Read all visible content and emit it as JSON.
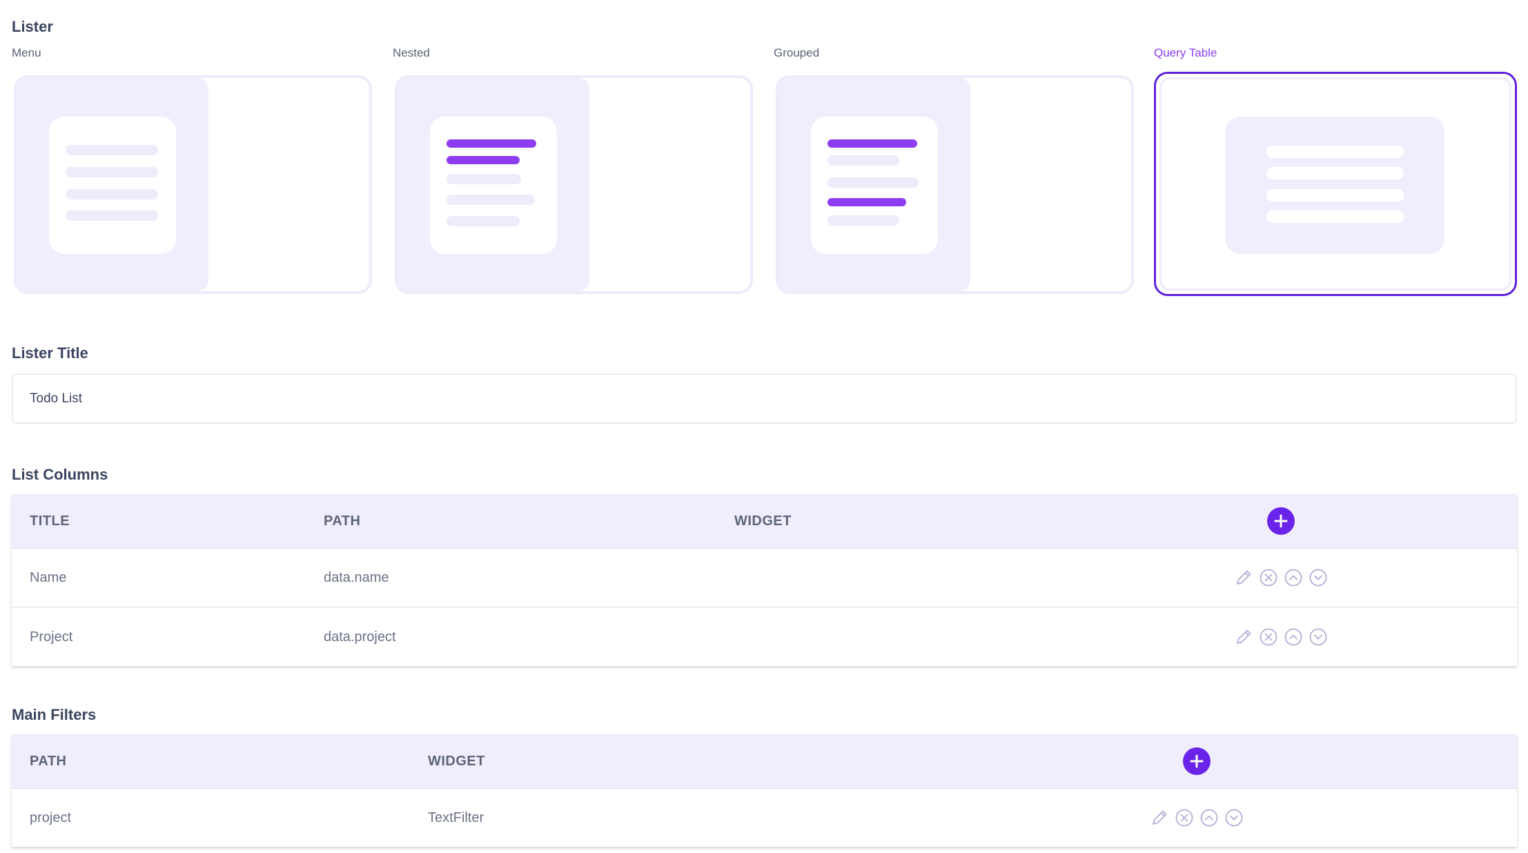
{
  "lister": {
    "heading": "Lister",
    "layouts": [
      {
        "label": "Menu",
        "style": "menu",
        "selected": false
      },
      {
        "label": "Nested",
        "style": "nested",
        "selected": false
      },
      {
        "label": "Grouped",
        "style": "grouped",
        "selected": false
      },
      {
        "label": "Query Table",
        "style": "query-table",
        "selected": true
      }
    ]
  },
  "lister_title": {
    "heading": "Lister Title",
    "value": "Todo List"
  },
  "list_columns": {
    "heading": "List Columns",
    "headers": {
      "title": "TITLE",
      "path": "PATH",
      "widget": "WIDGET"
    },
    "rows": [
      {
        "title": "Name",
        "path": "data.name",
        "widget": ""
      },
      {
        "title": "Project",
        "path": "data.project",
        "widget": ""
      }
    ],
    "row_actions": [
      "pencil-icon",
      "close-circle-icon",
      "chevron-up-circle-icon",
      "chevron-down-circle-icon"
    ]
  },
  "main_filters": {
    "heading": "Main Filters",
    "headers": {
      "path": "PATH",
      "widget": "WIDGET"
    },
    "rows": [
      {
        "path": "project",
        "widget": "TextFilter"
      }
    ],
    "row_actions": [
      "pencil-icon",
      "close-circle-icon",
      "chevron-up-circle-icon",
      "chevron-down-circle-icon"
    ]
  },
  "colors": {
    "accent": "#6a23e8",
    "accent_light": "#8d3df0",
    "panel": "#f0eefd",
    "icon": "#b2aed6"
  }
}
